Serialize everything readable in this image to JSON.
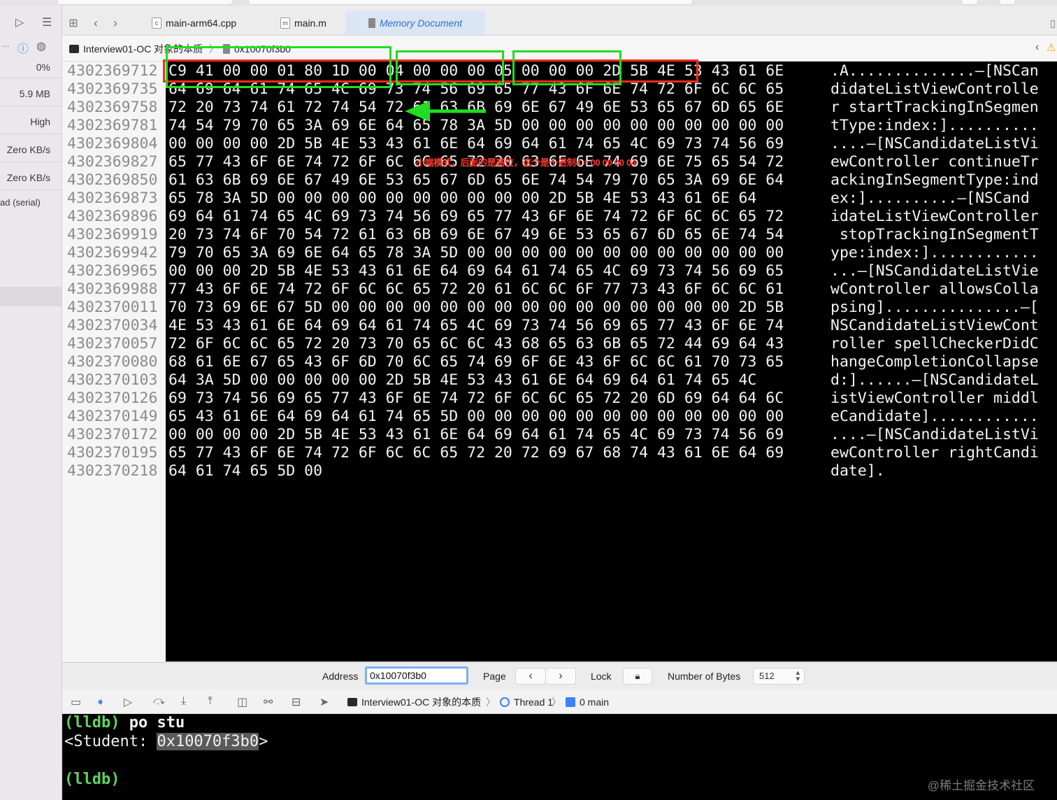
{
  "tabs": [
    {
      "label": "main-arm64.cpp",
      "icon": "c++"
    },
    {
      "label": "main.m",
      "icon": "m"
    },
    {
      "label": "Memory Document",
      "icon": "memory"
    }
  ],
  "jumpbar": {
    "project": "Interview01-OC 对象的本质",
    "document": "0x10070f3b0"
  },
  "sidebar": {
    "cpu": "0%",
    "memory": "5.9 MB",
    "energy": "High",
    "disk": "Zero KB/s",
    "network": "Zero KB/s",
    "thread": "ad (serial)"
  },
  "memory": {
    "rows": [
      {
        "address": "4302369712",
        "hex": "C9 41 00 00 01 80 1D 00 04 00 00 00 05 00 00 00 2D 5B 4E 53 43 61 6E",
        "ascii": ".A..............–[NSCan"
      },
      {
        "address": "4302369735",
        "hex": "64 69 64 61 74 65 4C 69 73 74 56 69 65 77 43 6F 6E 74 72 6F 6C 6C 65",
        "ascii": "didateListViewControlle"
      },
      {
        "address": "4302369758",
        "hex": "72 20 73 74 61 72 74 54 72 61 63 6B 69 6E 67 49 6E 53 65 67 6D 65 6E",
        "ascii": "r startTrackingInSegmen"
      },
      {
        "address": "4302369781",
        "hex": "74 54 79 70 65 3A 69 6E 64 65 78 3A 5D 00 00 00 00 00 00 00 00 00 00",
        "ascii": "tType:index:].........."
      },
      {
        "address": "4302369804",
        "hex": "00 00 00 00 2D 5B 4E 53 43 61 6E 64 69 64 61 74 65 4C 69 73 74 56 69",
        "ascii": "....–[NSCandidateListVi"
      },
      {
        "address": "4302369827",
        "hex": "65 77 43 6F 6E 74 72 6F 6C 6C 65 72 20 63 6F 6E 74 69 6E 75 65 54 72",
        "ascii": "ewController continueTr"
      },
      {
        "address": "4302369850",
        "hex": "61 63 6B 69 6E 67 49 6E 53 65 67 6D 65 6E 74 54 79 70 65 3A 69 6E 64",
        "ascii": "ackingInSegmentType:ind"
      },
      {
        "address": "4302369873",
        "hex": "65 78 3A 5D 00 00 00 00 00 00 00 00 00 00 2D 5B 4E 53 43 61 6E 64",
        "ascii": "ex:]..........–[NSCand"
      },
      {
        "address": "4302369896",
        "hex": "69 64 61 74 65 4C 69 73 74 56 69 65 77 43 6F 6E 74 72 6F 6C 6C 65 72",
        "ascii": "idateListViewController"
      },
      {
        "address": "4302369919",
        "hex": "20 73 74 6F 70 54 72 61 63 6B 69 6E 67 49 6E 53 65 67 6D 65 6E 74 54",
        "ascii": " stopTrackingInSegmentT"
      },
      {
        "address": "4302369942",
        "hex": "79 70 65 3A 69 6E 64 65 78 3A 5D 00 00 00 00 00 00 00 00 00 00 00 00",
        "ascii": "ype:index:]............"
      },
      {
        "address": "4302369965",
        "hex": "00 00 00 2D 5B 4E 53 43 61 6E 64 69 64 61 74 65 4C 69 73 74 56 69 65",
        "ascii": "...–[NSCandidateListVie"
      },
      {
        "address": "4302369988",
        "hex": "77 43 6F 6E 74 72 6F 6C 6C 65 72 20 61 6C 6C 6F 77 73 43 6F 6C 6C 61",
        "ascii": "wController allowsColla"
      },
      {
        "address": "4302370011",
        "hex": "70 73 69 6E 67 5D 00 00 00 00 00 00 00 00 00 00 00 00 00 00 00 2D 5B",
        "ascii": "psing]...............–["
      },
      {
        "address": "4302370034",
        "hex": "4E 53 43 61 6E 64 69 64 61 74 65 4C 69 73 74 56 69 65 77 43 6F 6E 74",
        "ascii": "NSCandidateListViewCont"
      },
      {
        "address": "4302370057",
        "hex": "72 6F 6C 6C 65 72 20 73 70 65 6C 6C 43 68 65 63 6B 65 72 44 69 64 43",
        "ascii": "roller spellCheckerDidC"
      },
      {
        "address": "4302370080",
        "hex": "68 61 6E 67 65 43 6F 6D 70 6C 65 74 69 6F 6E 43 6F 6C 6C 61 70 73 65",
        "ascii": "hangeCompletionCollapse"
      },
      {
        "address": "4302370103",
        "hex": "64 3A 5D 00 00 00 00 00 2D 5B 4E 53 43 61 6E 64 69 64 61 74 65 4C",
        "ascii": "d:]......–[NSCandidateL"
      },
      {
        "address": "4302370126",
        "hex": "69 73 74 56 69 65 77 43 6F 6E 74 72 6F 6C 6C 65 72 20 6D 69 64 64 6C",
        "ascii": "istViewController middl"
      },
      {
        "address": "4302370149",
        "hex": "65 43 61 6E 64 69 64 61 74 65 5D 00 00 00 00 00 00 00 00 00 00 00 00",
        "ascii": "eCandidate]............"
      },
      {
        "address": "4302370172",
        "hex": "00 00 00 00 2D 5B 4E 53 43 61 6E 64 69 64 61 74 65 4C 69 73 74 56 69",
        "ascii": "....–[NSCandidateListVi"
      },
      {
        "address": "4302370195",
        "hex": "65 77 43 6F 6E 74 72 6F 6C 6C 65 72 20 72 69 67 68 74 43 61 6E 64 69",
        "ascii": "ewController rightCandi"
      },
      {
        "address": "4302370218",
        "hex": "64 61 74 65 5D 00",
        "ascii": "date]."
      }
    ],
    "annotation_text": "小端模式，后面的是高位，这个是十进制4 = 00 00 00 04"
  },
  "address_bar": {
    "address_label": "Address",
    "address_value": "0x10070f3b0",
    "page_label": "Page",
    "lock_label": "Lock",
    "bytes_label": "Number of Bytes",
    "bytes_value": "512"
  },
  "debug_bar": {
    "project": "Interview01-OC 对象的本质",
    "thread": "Thread 1",
    "frame": "0 main"
  },
  "console": {
    "prompt": "(lldb)",
    "command": "po stu",
    "output_prefix": "<Student: ",
    "output_address": "0x10070f3b0",
    "output_suffix": ">",
    "watermark": "@稀土掘金技术社区"
  },
  "colors": {
    "green_box": "#22dd22",
    "red_box": "#ff2a1a",
    "prompt_green": "#5fd35f",
    "accent_blue": "#2f6fd6"
  }
}
